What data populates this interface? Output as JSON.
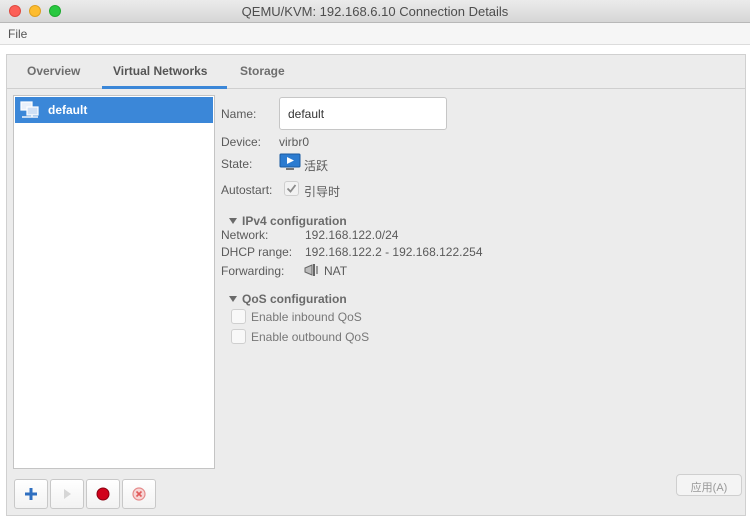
{
  "window": {
    "title": "QEMU/KVM: 192.168.6.10 Connection Details"
  },
  "menu": {
    "file": "File"
  },
  "tabs": [
    {
      "label": "Overview",
      "active": false
    },
    {
      "label": "Virtual Networks",
      "active": true
    },
    {
      "label": "Storage",
      "active": false
    }
  ],
  "networks": [
    {
      "label": "default",
      "icon": "network-icon",
      "selected": true
    }
  ],
  "toolbar": {
    "add": "add-network-icon",
    "start": "start-network-icon",
    "stop": "stop-network-icon",
    "delete": "delete-network-icon"
  },
  "details": {
    "name_label": "Name:",
    "name_value": "default",
    "device_label": "Device:",
    "device_value": "virbr0",
    "state_label": "State:",
    "state_value": "活跃",
    "autostart_label": "Autostart:",
    "autostart_value": "引导时",
    "autostart_checked": true
  },
  "ipv4": {
    "heading": "IPv4 configuration",
    "network_label": "Network:",
    "network_value": "192.168.122.0/24",
    "dhcp_label": "DHCP range:",
    "dhcp_value": "192.168.122.2 - 192.168.122.254",
    "forwarding_label": "Forwarding:",
    "forwarding_value": "NAT"
  },
  "qos": {
    "heading": "QoS configuration",
    "inbound_label": "Enable inbound QoS",
    "inbound_checked": false,
    "outbound_label": "Enable outbound QoS",
    "outbound_checked": false
  },
  "footer": {
    "apply_label": "应用(A)"
  },
  "colors": {
    "accent": "#3b87d8",
    "stop_red": "#d0021b"
  }
}
